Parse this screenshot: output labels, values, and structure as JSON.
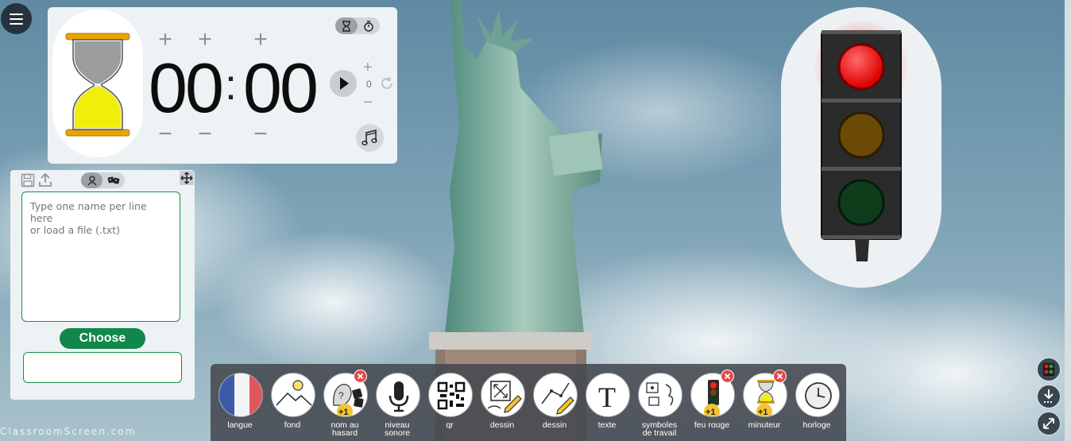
{
  "timer": {
    "minutes": "00",
    "seconds": "00",
    "colon": ":",
    "plus": "+",
    "minus": "−",
    "repeat_count": "0"
  },
  "name_picker": {
    "placeholder": "Type one name per line here\nor load a file (.txt)",
    "choose_label": "Choose",
    "result": ""
  },
  "toolbar": {
    "tools": [
      {
        "label": "langue",
        "icon": "flag-france-icon"
      },
      {
        "label": "fond",
        "icon": "landscape-icon"
      },
      {
        "label": "nom au\nhasard",
        "icon": "random-name-icon"
      },
      {
        "label": "niveau\nsonore",
        "icon": "microphone-icon"
      },
      {
        "label": "qr",
        "icon": "qr-code-icon"
      },
      {
        "label": "dessin",
        "icon": "draw-frame-icon"
      },
      {
        "label": "dessin",
        "icon": "draw-pencil-icon"
      },
      {
        "label": "texte",
        "icon": "text-t-icon"
      },
      {
        "label": "symboles\nde travail",
        "icon": "work-symbols-icon"
      },
      {
        "label": "feu rouge",
        "icon": "traffic-light-icon"
      },
      {
        "label": "minuteur",
        "icon": "hourglass-icon"
      },
      {
        "label": "horloge",
        "icon": "clock-icon"
      }
    ],
    "badge_plus_one": "+1"
  },
  "traffic_light": {
    "active": "red",
    "colors": {
      "red": "#ff1010",
      "amber": "#6b4a05",
      "green": "#0f3d1c"
    }
  },
  "watermark": "ClassroomScreen.com",
  "colors": {
    "accent_green": "#11874b",
    "close_red": "#e44b4b"
  }
}
